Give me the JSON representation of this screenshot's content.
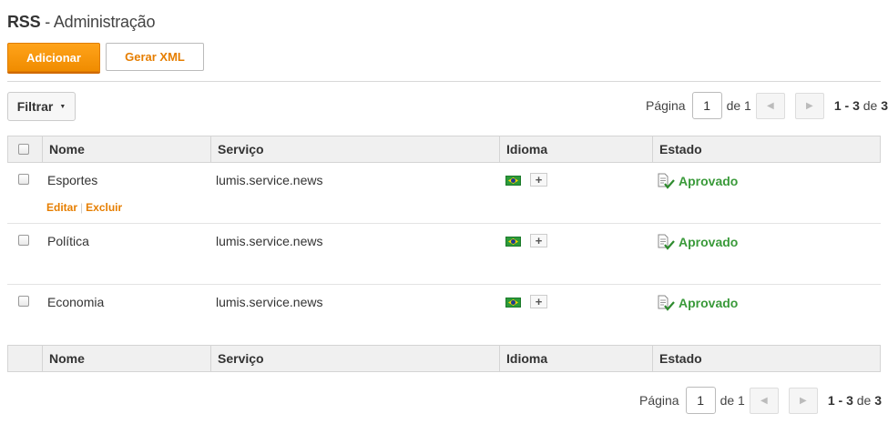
{
  "header": {
    "title_bold": "RSS",
    "title_rest": " - Administração"
  },
  "toolbar": {
    "add_label": "Adicionar",
    "xml_label": "Gerar XML"
  },
  "filter": {
    "label": "Filtrar"
  },
  "pager": {
    "page_label": "Página",
    "page_value": "1",
    "of_label": "de 1",
    "range": "1 - 3",
    "range_of": " de ",
    "total": "3"
  },
  "table": {
    "columns": [
      "Nome",
      "Serviço",
      "Idioma",
      "Estado"
    ],
    "rows": [
      {
        "name": "Esportes",
        "service": "lumis.service.news",
        "status": "Aprovado"
      },
      {
        "name": "Política",
        "service": "lumis.service.news",
        "status": "Aprovado"
      },
      {
        "name": "Economia",
        "service": "lumis.service.news",
        "status": "Aprovado"
      }
    ],
    "row_actions": {
      "edit": "Editar",
      "sep": "|",
      "delete": "Excluir"
    },
    "language_add": "+"
  },
  "icons": {
    "filter_caret": "caret-down-icon",
    "prev": "chevron-left-icon",
    "next": "chevron-right-icon",
    "flag": "brazil-flag-icon",
    "status": "approved-document-icon"
  },
  "colors": {
    "accent": "#f5940a",
    "status_green": "#3a9a3a",
    "link": "#e67e00"
  }
}
